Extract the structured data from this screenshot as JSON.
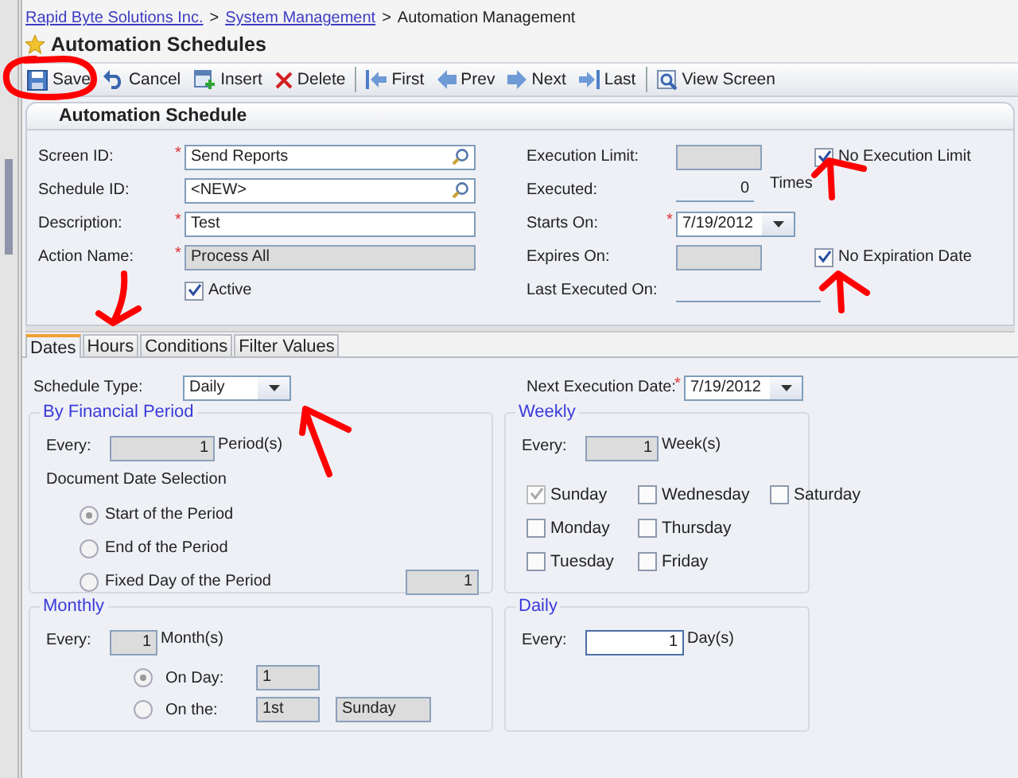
{
  "breadcrumb": [
    {
      "kind": "link",
      "text": "Rapid Byte Solutions Inc."
    },
    {
      "kind": "separator",
      "text": ">"
    },
    {
      "kind": "link",
      "text": "System Management"
    },
    {
      "kind": "separator",
      "text": ">"
    },
    {
      "kind": "current",
      "text": "Automation Management"
    }
  ],
  "title": "Automation Schedules",
  "toolbar": [
    {
      "kind": "save",
      "label": "Save"
    },
    {
      "kind": "cancel",
      "label": "Cancel"
    },
    {
      "kind": "insert",
      "label": "Insert"
    },
    {
      "kind": "delete",
      "label": "Delete"
    },
    {
      "kind": "separator"
    },
    {
      "kind": "first",
      "label": "First"
    },
    {
      "kind": "prev",
      "label": "Prev"
    },
    {
      "kind": "next",
      "label": "Next"
    },
    {
      "kind": "last",
      "label": "Last"
    },
    {
      "kind": "separator"
    },
    {
      "kind": "view",
      "label": "View Screen"
    }
  ],
  "section_title": "Automation Schedule",
  "form": {
    "left_fields": [
      {
        "kind": "lookup",
        "label": "Screen ID:",
        "required_mark": "*",
        "value": "Send Reports"
      },
      {
        "kind": "lookup",
        "label": "Schedule ID:",
        "value": "<NEW>"
      },
      {
        "kind": "text",
        "label": "Description:",
        "required_mark": "*",
        "value": "Test"
      },
      {
        "kind": "readonly",
        "label": "Action Name:",
        "required_mark": "*",
        "value": "Process All"
      }
    ],
    "active": {
      "label": "Active",
      "checked": true
    },
    "right_fields": [
      {
        "kind": "readonly",
        "label": "Execution Limit:",
        "option": {
          "label": "No Execution Limit",
          "checked": true
        }
      },
      {
        "kind": "underline",
        "label": "Executed:",
        "value": "0",
        "suffix": "Times"
      },
      {
        "kind": "date",
        "label": "Starts On:",
        "required_mark": "*",
        "value": "7/19/2012"
      },
      {
        "kind": "readonly",
        "label": "Expires On:",
        "option": {
          "label": "No Expiration Date",
          "checked": true
        }
      },
      {
        "kind": "underline",
        "label": "Last Executed On:"
      }
    ]
  },
  "tabs": [
    {
      "label": "Dates",
      "selected": true
    },
    {
      "label": "Hours",
      "selected": false
    },
    {
      "label": "Conditions",
      "selected": false
    },
    {
      "label": "Filter Values",
      "selected": false
    }
  ],
  "schedule_type": {
    "label": "Schedule Type:",
    "value": "Daily"
  },
  "next_execution": {
    "label": "Next Execution Date:",
    "required_mark": "*",
    "value": "7/19/2012"
  },
  "financial_period": {
    "title": "By Financial Period",
    "every_label": "Every:",
    "every": "1",
    "unit": "Period(s)",
    "subtitle": "Document Date Selection",
    "options": [
      {
        "label": "Start of the Period",
        "selected": true
      },
      {
        "label": "End of the Period",
        "selected": false
      },
      {
        "label": "Fixed Day of the Period",
        "selected": false,
        "value": "1"
      }
    ]
  },
  "weekly": {
    "title": "Weekly",
    "every_label": "Every:",
    "every": "1",
    "unit": "Week(s)",
    "days": [
      {
        "label": "Sunday",
        "checked": true
      },
      {
        "label": "Monday",
        "checked": false
      },
      {
        "label": "Tuesday",
        "checked": false
      },
      {
        "label": "Wednesday",
        "checked": false
      },
      {
        "label": "Thursday",
        "checked": false
      },
      {
        "label": "Friday",
        "checked": false
      },
      {
        "label": "Saturday",
        "checked": false
      }
    ]
  },
  "monthly": {
    "title": "Monthly",
    "every_label": "Every:",
    "every": "1",
    "unit": "Month(s)",
    "options": [
      {
        "label": "On Day:",
        "selected": true,
        "values": [
          "1"
        ]
      },
      {
        "label": "On the:",
        "selected": false,
        "values": [
          "1st",
          "Sunday"
        ]
      }
    ]
  },
  "daily": {
    "title": "Daily",
    "every_label": "Every:",
    "every": "1",
    "unit": "Day(s)"
  }
}
